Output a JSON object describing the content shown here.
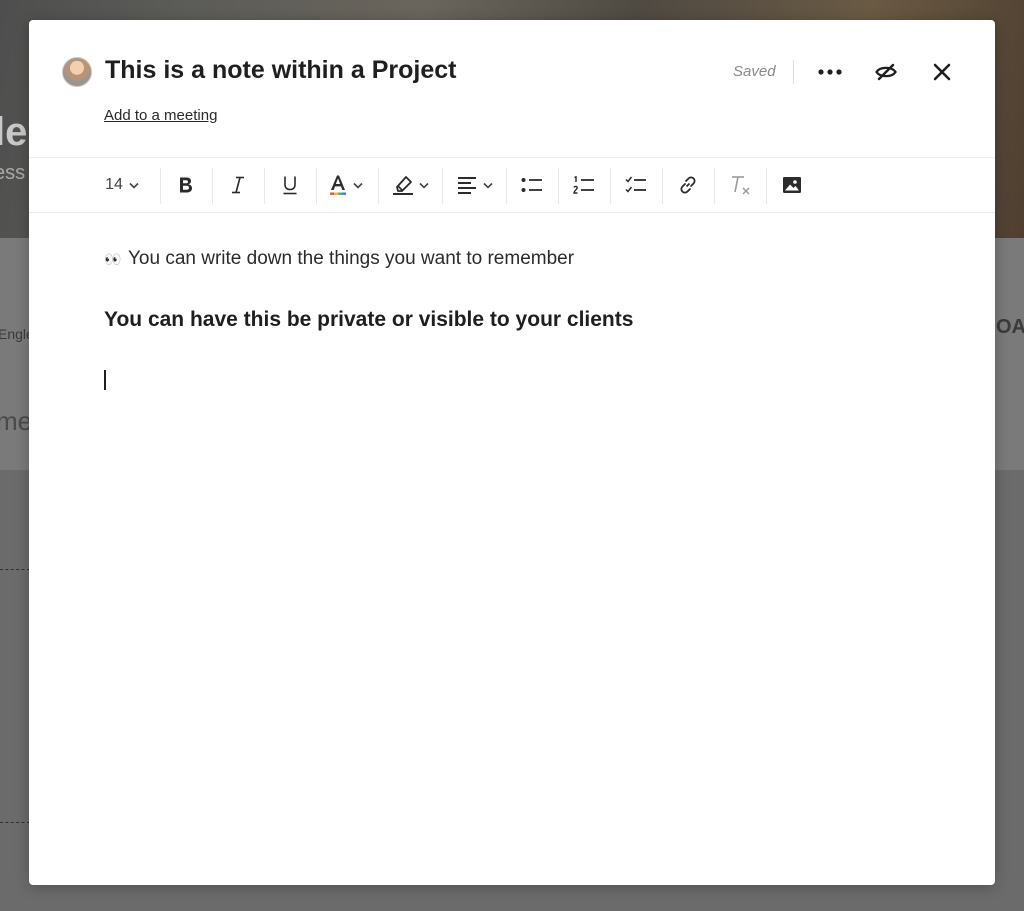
{
  "backdrop": {
    "hero_title": "le",
    "hero_subtitle": "ess",
    "left_label": "Engle",
    "left_big": "me",
    "right_label": "OA"
  },
  "note": {
    "title": "This is a note within a Project",
    "add_meeting_link": "Add to a meeting",
    "saved_status": "Saved"
  },
  "header_icons": [
    "more-icon",
    "visibility-off-icon",
    "close-icon"
  ],
  "toolbar": {
    "font_size": "14",
    "buttons": [
      "font-size-select",
      "bold",
      "italic",
      "underline",
      "text-color",
      "highlight",
      "align",
      "bullet-list",
      "numbered-list",
      "checklist",
      "link",
      "clear-format",
      "image"
    ]
  },
  "content": {
    "emoji": "👀",
    "line1": "You can write down the things you want to remember",
    "line2": "You can have this be private or visible to your clients"
  },
  "colors": {
    "overlay": "#6b6b6b",
    "modal_bg": "#ffffff",
    "text": "#1f1f1f",
    "muted": "#8a8a8a"
  }
}
